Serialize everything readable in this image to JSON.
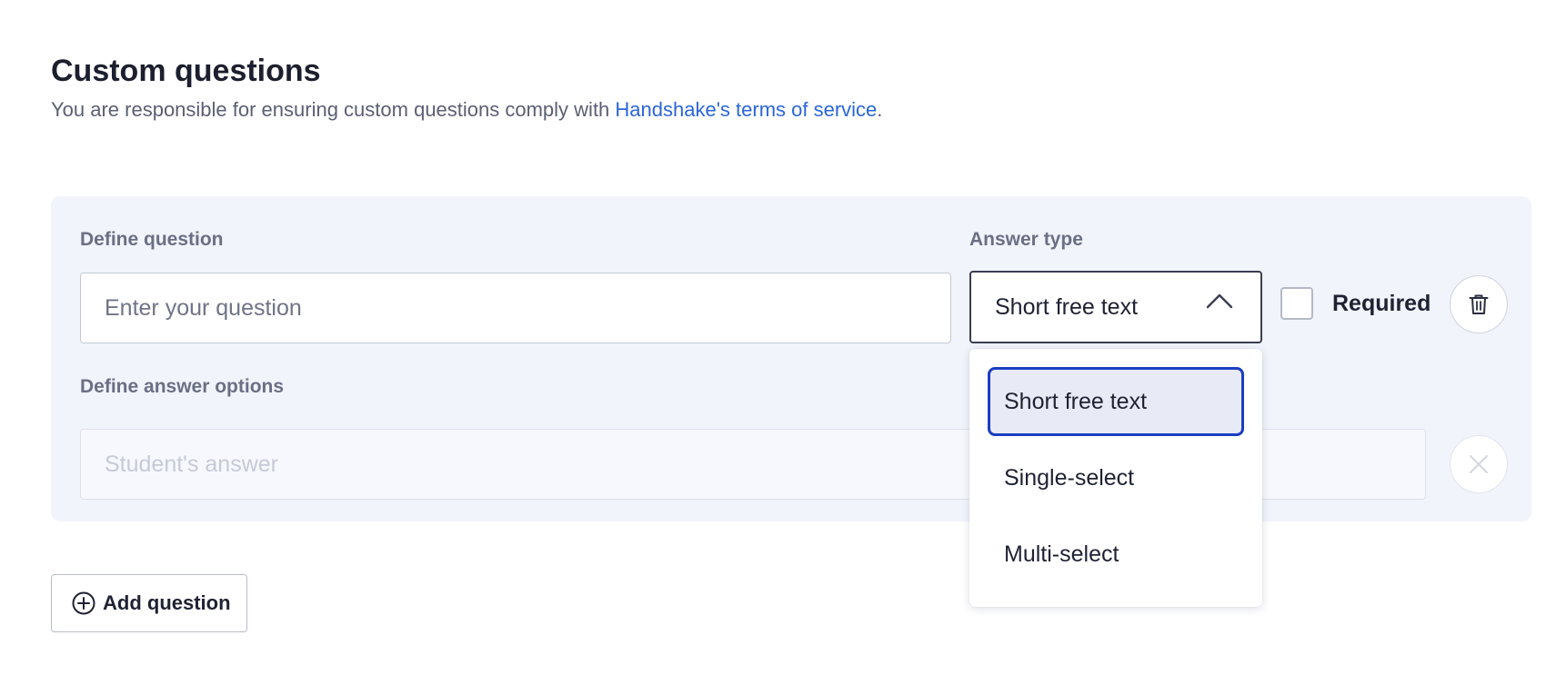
{
  "header": {
    "title": "Custom questions",
    "subtitle_prefix": "You are responsible for ensuring custom questions comply with ",
    "terms_link": "Handshake's terms of service",
    "subtitle_suffix": "."
  },
  "question_card": {
    "define_question_label": "Define question",
    "question_input": {
      "placeholder": "Enter your question",
      "value": ""
    },
    "answer_type_label": "Answer type",
    "answer_type_select": {
      "selected": "Short free text",
      "expanded": true,
      "options": [
        "Short free text",
        "Single-select",
        "Multi-select"
      ]
    },
    "required_checkbox": {
      "label": "Required",
      "checked": false
    },
    "define_answer_options_label": "Define answer options",
    "answer_input": {
      "placeholder": "Student's answer",
      "disabled": true
    },
    "icons": {
      "delete": "trash-icon",
      "clear": "close-icon",
      "dropdown": "chevron-up-icon"
    }
  },
  "add_question_button": {
    "label": "Add question",
    "icon": "plus-circle-icon"
  },
  "colors": {
    "link": "#2b66d9",
    "panel_bg": "#f1f4fb",
    "selected_option_border": "#1a3dc1",
    "selected_option_bg": "#e8eaf5"
  }
}
